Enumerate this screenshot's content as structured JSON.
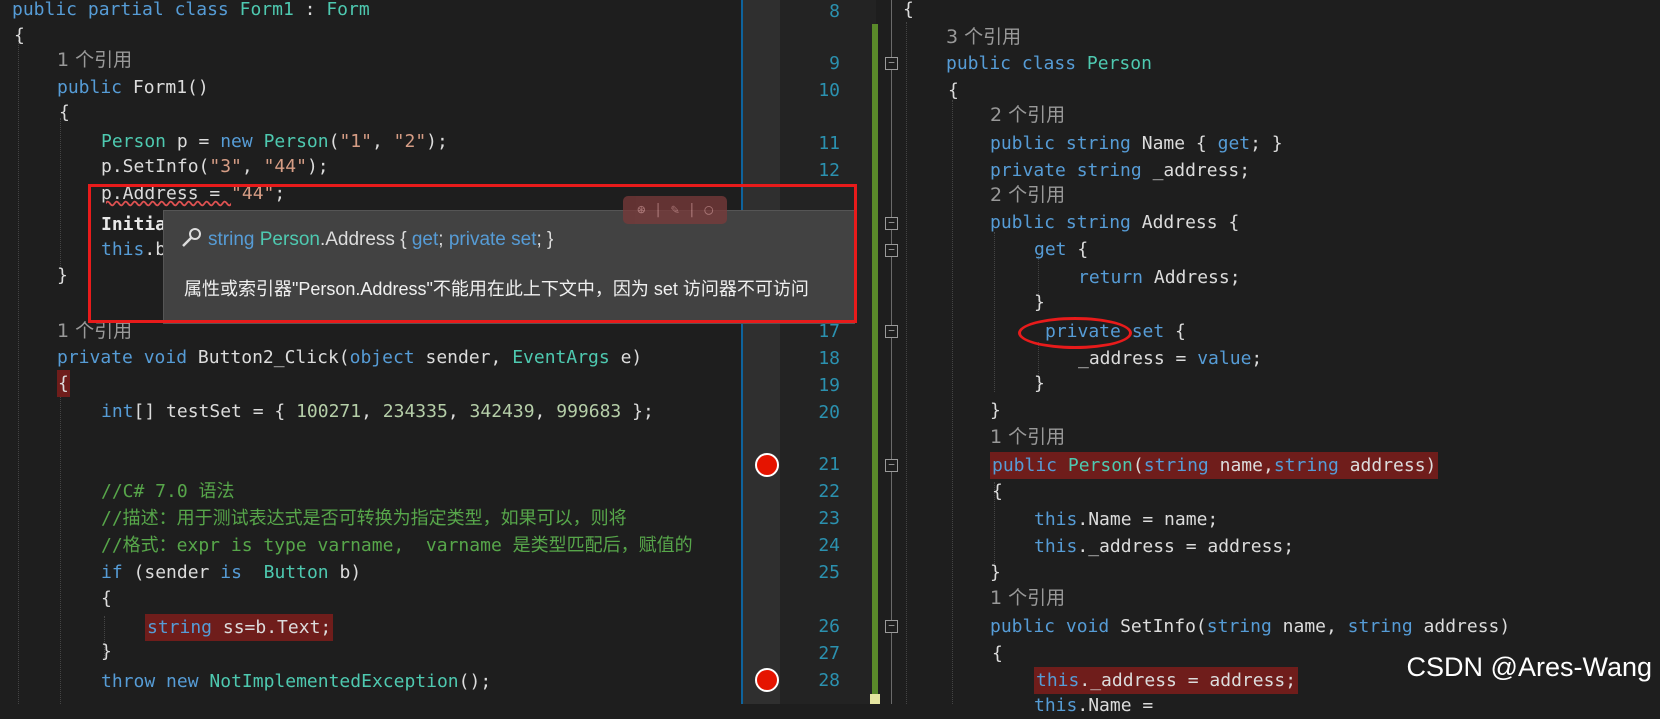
{
  "left": {
    "lines": {
      "class_decl": {
        "kw1": "public",
        "kw2": "partial",
        "kw3": "class",
        "name": "Form1",
        "colon": " : ",
        "base": "Form"
      },
      "brace_open_1": "{",
      "ref1": "1 个引用",
      "ctor_decl": {
        "kw": "public",
        "rest": " Form1()"
      },
      "brace_open_2": "{",
      "person_new": {
        "type1": "Person",
        "mid": " p = ",
        "kw": "new",
        "type2": "Person",
        "args": "(",
        "s1": "\"1\"",
        "comma": ", ",
        "s2": "\"2\"",
        "end": ");"
      },
      "setinfo": {
        "pre": "p.SetInfo(",
        "s1": "\"3\"",
        "comma": ", ",
        "s2": "\"44\"",
        "end": ");"
      },
      "address_assign": {
        "pre": "p.Address = ",
        "s1": "\"44\"",
        "end": ";"
      },
      "initia": "Initia",
      "this_b": {
        "kw": "this",
        "rest": ".b"
      },
      "brace_close_2": "}",
      "ref2": "1 个引用",
      "button_decl": {
        "kw1": "private",
        "kw2": "void",
        "name": " Button2_Click(",
        "kw3": "object",
        "mid": " sender, ",
        "type": "EventArgs",
        "end": " e)"
      },
      "brace_open_3": "{",
      "testset": {
        "kw": "int",
        "mid": "[] testSet = { ",
        "v1": "100271",
        "c1": ", ",
        "v2": "234335",
        "c2": ", ",
        "v3": "342439",
        "c3": ", ",
        "v4": "999683",
        "end": " };"
      },
      "comment1": "//C# 7.0 语法",
      "comment2": "//描述：用于测试表达式是否可转换为指定类型，如果可以，则将",
      "comment3": "//格式：expr is type varname,  varname 是类型匹配后，赋值的",
      "if_line": {
        "kw": "if",
        "pre": " (sender ",
        "kw2": "is",
        "mid": "  ",
        "type": "Button",
        "end": " b)"
      },
      "brace_open_4": "{",
      "string_ss": {
        "kw": "string",
        "rest": " ss=b.Text;"
      },
      "brace_close_4": "}",
      "throw_line": {
        "kw1": "throw",
        "kw2": "new",
        "type": "NotImplementedException",
        "end": "();"
      }
    }
  },
  "tooltip": {
    "signature": {
      "kw1": "string",
      "type": "Person",
      "dot_prop": ".Address { ",
      "get": "get",
      "semi": "; ",
      "priv": "private",
      "set": "set",
      "end": "; }"
    },
    "message": "属性或索引器\"Person.Address\"不能用在此上下文中，因为 set 访问器不可访问",
    "toolbar_glyphs": "⊛ | ✎ | ◯"
  },
  "right": {
    "line_numbers": [
      "8",
      "9",
      "10",
      "11",
      "12",
      "17",
      "18",
      "19",
      "20",
      "21",
      "22",
      "23",
      "24",
      "25",
      "26",
      "27",
      "28"
    ],
    "lines": {
      "brace_open_1": "{",
      "ref3": "3 个引用",
      "class_person": {
        "kw1": "public",
        "kw2": "class",
        "name": "Person"
      },
      "brace_open_2": "{",
      "ref_name": "2 个引用",
      "name_prop": {
        "kw1": "public",
        "kw2": "string",
        "mid": " Name { ",
        "get": "get",
        "end": "; }"
      },
      "address_field": {
        "kw1": "private",
        "kw2": "string",
        "rest": " _address;"
      },
      "ref_address": "2 个引用",
      "address_prop": {
        "kw1": "public",
        "kw2": "string",
        "rest": " Address {"
      },
      "get_open": {
        "kw": "get",
        "rest": " {"
      },
      "return_addr": {
        "kw": "return",
        "rest": " Address;"
      },
      "brace_close_get": "}",
      "private_set": {
        "kw1": "private",
        "kw2": "set",
        "rest": " {"
      },
      "assign_value": {
        "pre": "_address = ",
        "kw": "value",
        "end": ";"
      },
      "brace_close_set": "}",
      "brace_close_prop": "}",
      "ref_ctor": "1 个引用",
      "ctor": {
        "kw1": "public",
        "type": "Person",
        "p1": "(",
        "kw2": "string",
        "m1": " name,",
        "kw3": "string",
        "m2": " address)"
      },
      "brace_open_ctor": "{",
      "this_name": {
        "kw": "this",
        "rest": ".Name = name;"
      },
      "this_address": {
        "kw": "this",
        "rest": "._address = address;"
      },
      "brace_close_ctor": "}",
      "ref_setinfo": "1 个引用",
      "setinfo": {
        "kw1": "public",
        "kw2": "void",
        "name": " SetInfo(",
        "kw3": "string",
        "m1": " name, ",
        "kw4": "string",
        "m2": " address)"
      },
      "brace_open_si": "{",
      "this_addr2": {
        "kw": "this",
        "rest": "._address = address;"
      },
      "partial_next": {
        "kw": "this",
        "rest": ".Name = "
      }
    }
  },
  "watermark": "CSDN @Ares-Wang",
  "colors": {
    "keyword": "#569cd6",
    "type": "#4ec9b0",
    "string": "#d69d85",
    "number": "#b5cea8",
    "comment": "#57a64a",
    "highlight": "#6f1d1b",
    "annotation": "#e81b1b"
  }
}
